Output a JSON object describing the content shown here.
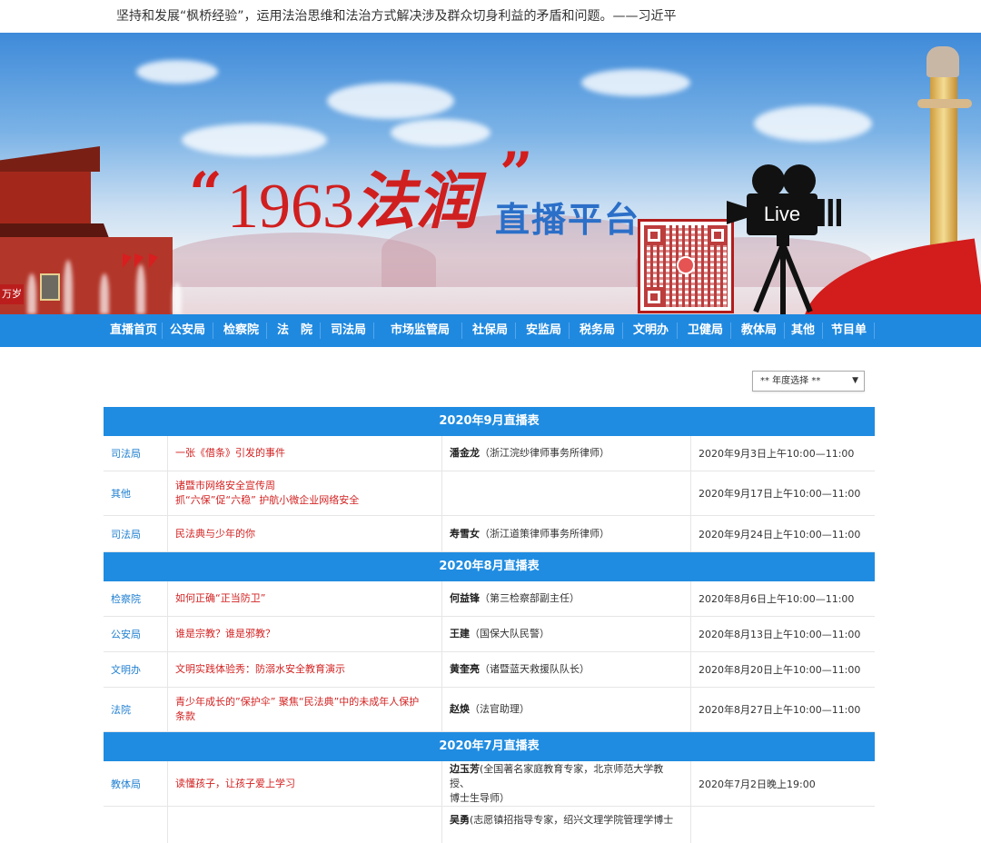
{
  "quote": "坚持和发展“枫桥经验”，运用法治思维和法治方式解决涉及群众切身利益的矛盾和问题。——习近平",
  "banner": {
    "quote_left": "“",
    "year": "1963",
    "brand": "法润",
    "quote_right": "”",
    "platform": "直播平台",
    "camera_label": "Live",
    "gate_sign": "万岁"
  },
  "nav": [
    {
      "label": "直播首页"
    },
    {
      "label": "公安局"
    },
    {
      "label": "检察院"
    },
    {
      "label": "法　院"
    },
    {
      "label": "司法局"
    },
    {
      "label": "市场监管局"
    },
    {
      "label": "社保局"
    },
    {
      "label": "安监局"
    },
    {
      "label": "税务局"
    },
    {
      "label": "文明办"
    },
    {
      "label": "卫健局"
    },
    {
      "label": "教体局"
    },
    {
      "label": "其他"
    },
    {
      "label": "节目单"
    }
  ],
  "year_select": {
    "value": "** 年度选择 **"
  },
  "sections": [
    {
      "title": "2020年9月直播表",
      "rows": [
        {
          "dept": "司法局",
          "topic": [
            "一张《借条》引发的事件"
          ],
          "guest_name": "潘金龙",
          "guest_role": "（浙江浣纱律师事务所律师）",
          "time": "2020年9月3日上午10:00—11:00"
        },
        {
          "dept": "其他",
          "topic": [
            "诸暨市网络安全宣传周",
            "抓“六保”促“六稳” 护航小微企业网络安全"
          ],
          "guest_name": "",
          "guest_role": "",
          "time": "2020年9月17日上午10:00—11:00"
        },
        {
          "dept": "司法局",
          "topic": [
            "民法典与少年的你"
          ],
          "guest_name": "寿雪女",
          "guest_role": "（浙江道策律师事务所律师）",
          "time": "2020年9月24日上午10:00—11:00"
        }
      ]
    },
    {
      "title": "2020年8月直播表",
      "rows": [
        {
          "dept": "检察院",
          "topic": [
            "如何正确“正当防卫”"
          ],
          "guest_name": "何益锋",
          "guest_role": "（第三检察部副主任）",
          "time": "2020年8月6日上午10:00—11:00"
        },
        {
          "dept": "公安局",
          "topic": [
            "谁是宗教？谁是邪教？"
          ],
          "guest_name": "王建",
          "guest_role": "（国保大队民警）",
          "time": "2020年8月13日上午10:00—11:00"
        },
        {
          "dept": "文明办",
          "topic": [
            "文明实践体验秀：防溺水安全教育演示"
          ],
          "guest_name": "黄奎亮",
          "guest_role": "（诸暨蓝天救援队队长）",
          "time": "2020年8月20日上午10:00—11:00"
        },
        {
          "dept": "法院",
          "topic": [
            "青少年成长的”保护伞” 聚焦“民法典”中的未成年人保护",
            "条款"
          ],
          "guest_name": "赵焕",
          "guest_role": "（法官助理）",
          "time": "2020年8月27日上午10:00—11:00"
        }
      ]
    },
    {
      "title": "2020年7月直播表",
      "rows": [
        {
          "dept": "教体局",
          "topic": [
            "读懂孩子，让孩子爱上学习"
          ],
          "guest_name": "边玉芳",
          "guest_role": "(全国著名家庭教育专家，北京师范大学教授、",
          "guest_role2": "博士生导师）",
          "time": "2020年7月2日晚上19:00"
        },
        {
          "dept": "",
          "topic": [
            ""
          ],
          "guest_name": "吴勇",
          "guest_role": "(志愿镇招指导专家，绍兴文理学院管理学博士",
          "time": ""
        }
      ]
    }
  ]
}
